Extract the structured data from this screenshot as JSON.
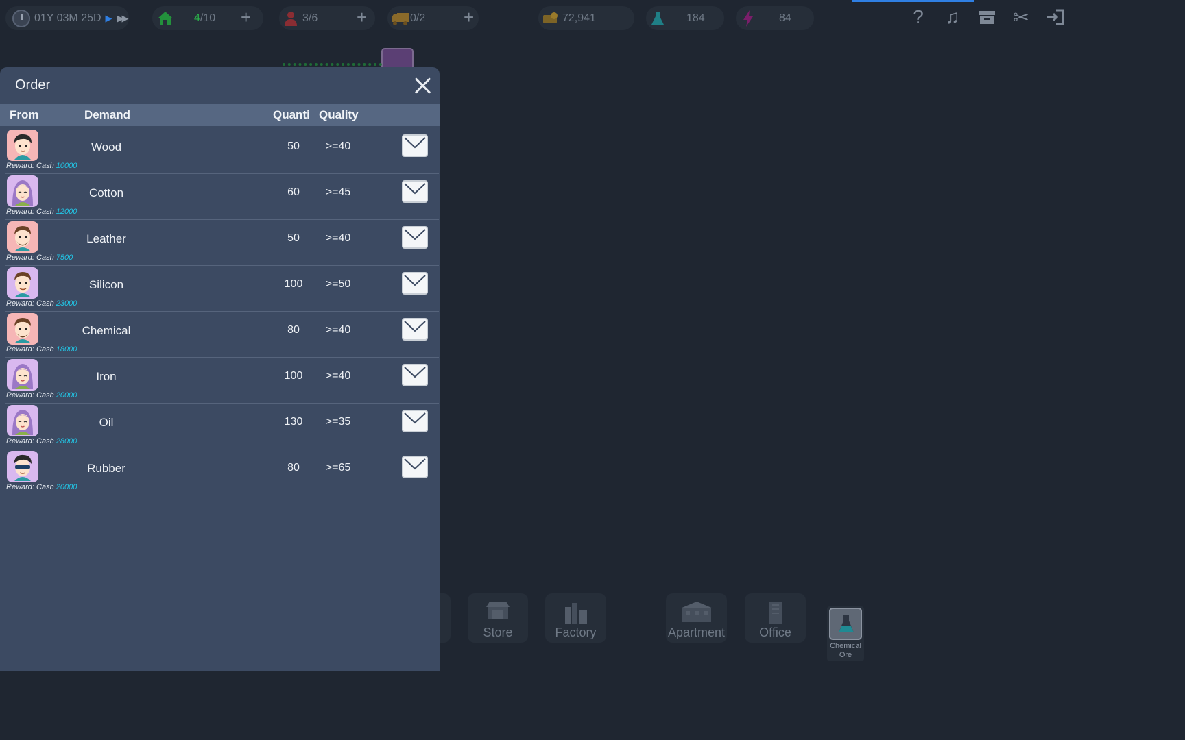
{
  "topbar": {
    "date": "01Y 03M 25D",
    "housing_current": "4",
    "housing_total": "/10",
    "staff": "3/6",
    "trucks": "0/2",
    "cash": "72,941",
    "research": "184",
    "energy": "84"
  },
  "dialog": {
    "title": "Order",
    "headers": {
      "from": "From",
      "demand": "Demand",
      "quantity": "Quanti",
      "quality": "Quality"
    },
    "reward_prefix": "Reward: Cash",
    "orders": [
      {
        "demand": "Wood",
        "quantity": "50",
        "quality": ">=40",
        "reward": "10000"
      },
      {
        "demand": "Cotton",
        "quantity": "60",
        "quality": ">=45",
        "reward": "12000"
      },
      {
        "demand": "Leather",
        "quantity": "50",
        "quality": ">=40",
        "reward": "7500"
      },
      {
        "demand": "Silicon",
        "quantity": "100",
        "quality": ">=50",
        "reward": "23000"
      },
      {
        "demand": "Chemical",
        "quantity": "80",
        "quality": ">=40",
        "reward": "18000"
      },
      {
        "demand": "Iron",
        "quantity": "100",
        "quality": ">=40",
        "reward": "20000"
      },
      {
        "demand": "Oil",
        "quantity": "130",
        "quality": ">=35",
        "reward": "28000"
      },
      {
        "demand": "Rubber",
        "quantity": "80",
        "quality": ">=65",
        "reward": "20000"
      }
    ]
  },
  "buildings": {
    "store": "Store",
    "factory": "Factory",
    "apartment": "Apartment",
    "office": "Office",
    "chemical_ore": "Chemical Ore"
  },
  "colors": {
    "accent_blue": "#2f7fe3",
    "reward_amount": "#22c6e6",
    "dialog_bg": "#3c4a62",
    "header_bg": "#566782"
  }
}
